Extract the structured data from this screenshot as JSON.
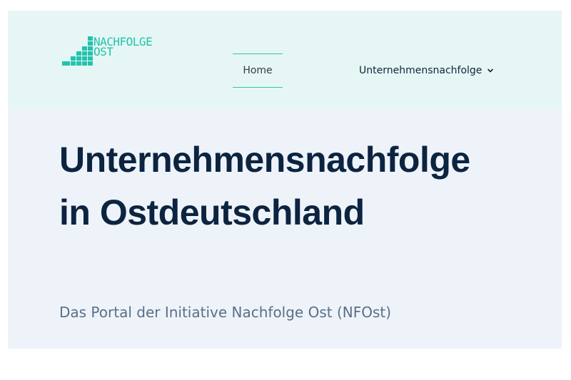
{
  "logo": {
    "line1": "NACHFOLGE",
    "line2": "OST",
    "color": "#22c3ad"
  },
  "nav": {
    "items": [
      {
        "label": "Home",
        "active": true
      },
      {
        "label": "Unternehmensnachfolge",
        "has_dropdown": true
      }
    ]
  },
  "hero": {
    "title_line1": "Unternehmensnachfolge",
    "title_line2": "in Ostdeutschland",
    "subtitle": "Das Portal der Initiative Nachfolge Ost (NFOst)"
  },
  "colors": {
    "accent": "#2fc6b0",
    "header_bg": "#e6f6f4",
    "hero_bg": "#eef3f9",
    "title": "#0c2440",
    "subtitle": "#5b6f86"
  }
}
